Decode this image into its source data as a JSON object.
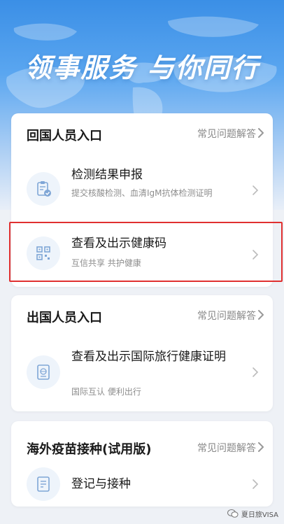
{
  "hero": {
    "title": "领事服务 与你同行"
  },
  "colors": {
    "accent": "#3b8fe6",
    "highlight_border": "#e03030",
    "icon_bg": "#eef4fb"
  },
  "return_entry": {
    "title": "回国人员入口",
    "faq_label": "常见问题解答",
    "items": [
      {
        "icon": "clipboard-check-icon",
        "title": "检测结果申报",
        "subtitle": "提交核酸检测、血清IgM抗体检测证明"
      },
      {
        "icon": "qr-code-icon",
        "title": "查看及出示健康码",
        "subtitle": "互信共享 共护健康"
      }
    ]
  },
  "departure_entry": {
    "title": "出国人员入口",
    "faq_label": "常见问题解答",
    "items": [
      {
        "icon": "passport-icon",
        "title": "查看及出示国际旅行健康证明",
        "subtitle": "国际互认 便利出行"
      }
    ]
  },
  "vaccine_entry": {
    "title": "海外疫苗接种(试用版)",
    "faq_label": "常见问题解答",
    "items": [
      {
        "icon": "form-icon",
        "title": "登记与接种"
      }
    ]
  },
  "watermark": {
    "text": "夏日旅VISA"
  }
}
